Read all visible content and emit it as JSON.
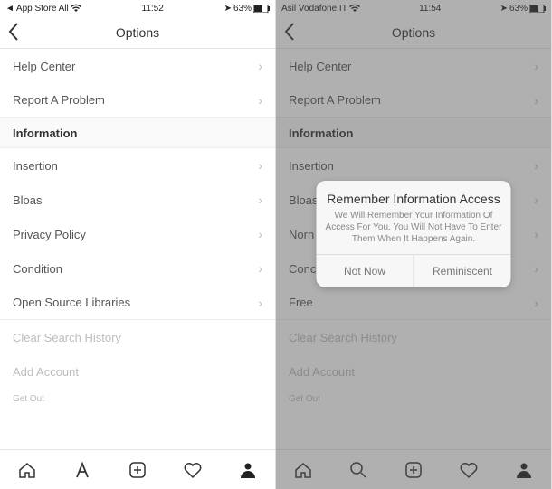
{
  "left": {
    "status": {
      "carrier": "App Store All",
      "time": "11:52",
      "battery": "63%"
    },
    "title": "Options",
    "rows": {
      "help": "Help Center",
      "report": "Report A Problem",
      "section": "Information",
      "insertion": "Insertion",
      "bloas": "Bloas",
      "privacy": "Privacy Policy",
      "condition": "Condition",
      "oss": "Open Source Libraries",
      "clear": "Clear Search History",
      "add": "Add Account",
      "out": "Get Out"
    }
  },
  "right": {
    "status": {
      "carrier": "Asil Vodafone IT",
      "time": "11:54",
      "battery": "63%"
    },
    "title": "Options",
    "rows": {
      "help": "Help Center",
      "report": "Report A Problem",
      "section": "Information",
      "insertion": "Insertion",
      "bloas": "Bloas",
      "norn": "Norn",
      "conc": "Conc",
      "free": "Free",
      "clear": "Clear Search History",
      "add": "Add Account",
      "out": "Get Out"
    },
    "dialog": {
      "title": "Remember Information Access",
      "message": "We Will Remember Your Information Of Access For You. You Will Not Have To Enter Them When It Happens Again.",
      "btn_left": "Not Now",
      "btn_right": "Reminiscent"
    }
  }
}
